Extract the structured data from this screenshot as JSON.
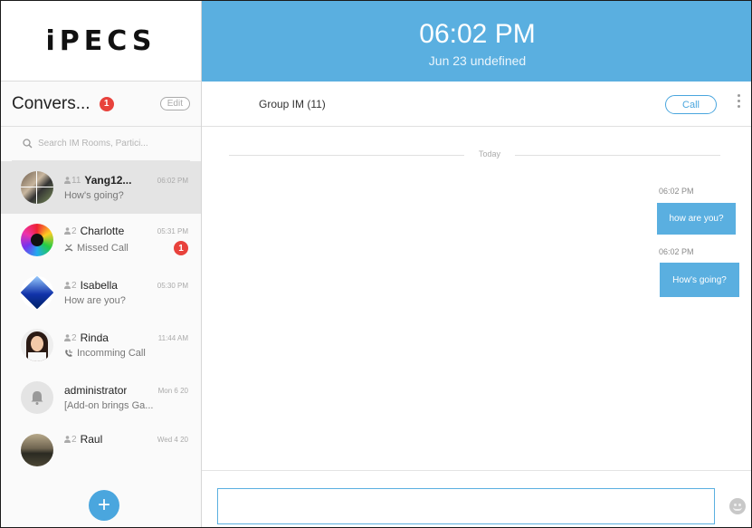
{
  "app": {
    "logo_text": "iPECS"
  },
  "header": {
    "time": "06:02 PM",
    "date": "Jun 23 undefined"
  },
  "sidebar": {
    "title": "Convers...",
    "unread_badge": "1",
    "edit_label": "Edit",
    "search_placeholder": "Search IM Rooms, Partici...",
    "conversations": [
      {
        "count": "11",
        "name": "Yang12...",
        "time": "06:02 PM",
        "preview": "How's going?",
        "active": true
      },
      {
        "count": "2",
        "name": "Charlotte",
        "time": "05:31 PM",
        "preview": "Missed Call",
        "badge": "1",
        "preview_icon": "missed-call-icon"
      },
      {
        "count": "2",
        "name": "Isabella",
        "time": "05:30 PM",
        "preview": "How are you?"
      },
      {
        "count": "2",
        "name": "Rinda",
        "time": "11:44 AM",
        "preview": "Incomming Call",
        "preview_icon": "incoming-call-icon"
      },
      {
        "count": "",
        "name": "administrator",
        "time": "Mon 6 20",
        "preview": "[Add-on brings Ga..."
      },
      {
        "count": "2",
        "name": "Raul",
        "time": "Wed 4 20",
        "preview": ""
      }
    ],
    "fab_label": "+"
  },
  "chat": {
    "title": "Group IM (11)",
    "call_label": "Call",
    "day_separator": "Today",
    "messages": [
      {
        "time": "06:02 PM",
        "text": "how are you?"
      },
      {
        "time": "06:02 PM",
        "text": "How's going?"
      }
    ],
    "composer_placeholder": ""
  },
  "colors": {
    "accent": "#5aafe0",
    "badge": "#e8423c"
  }
}
